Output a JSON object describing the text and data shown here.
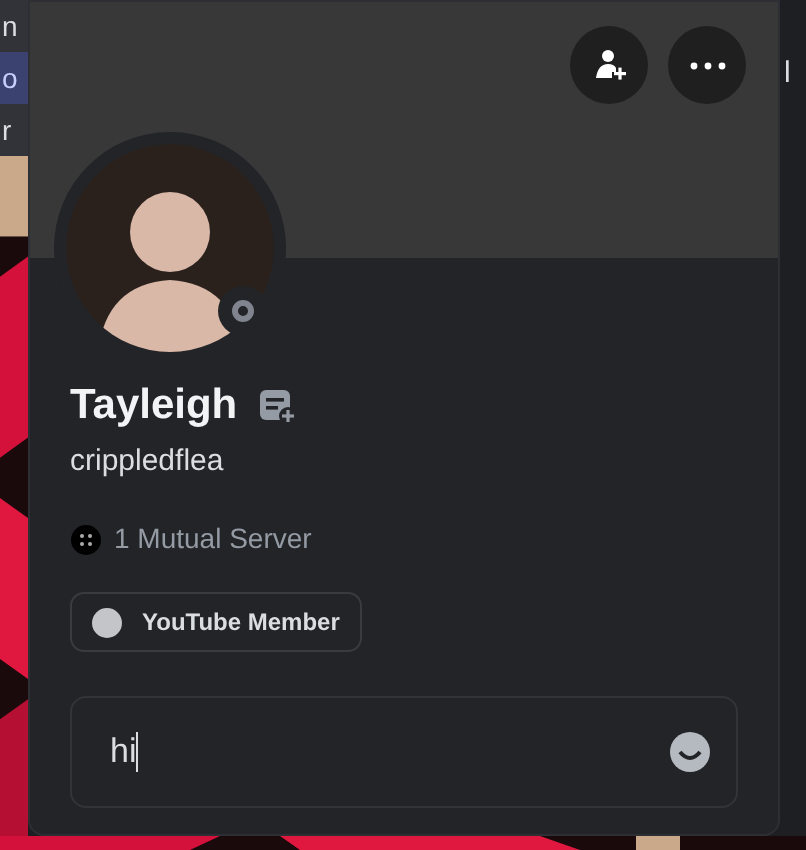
{
  "background": {
    "left_texts": [
      {
        "text": "n",
        "kind": "plain"
      },
      {
        "text": "o",
        "kind": "mention"
      },
      {
        "text": "r",
        "kind": "plain"
      }
    ],
    "right_text": "l"
  },
  "profile": {
    "display_name": "Tayleigh",
    "username": "crippledflea",
    "online": false,
    "mutual": "1 Mutual Server",
    "role": {
      "label": "YouTube Member",
      "color": "#c4c5c9"
    },
    "message": {
      "value": "hi",
      "focused": true
    }
  }
}
